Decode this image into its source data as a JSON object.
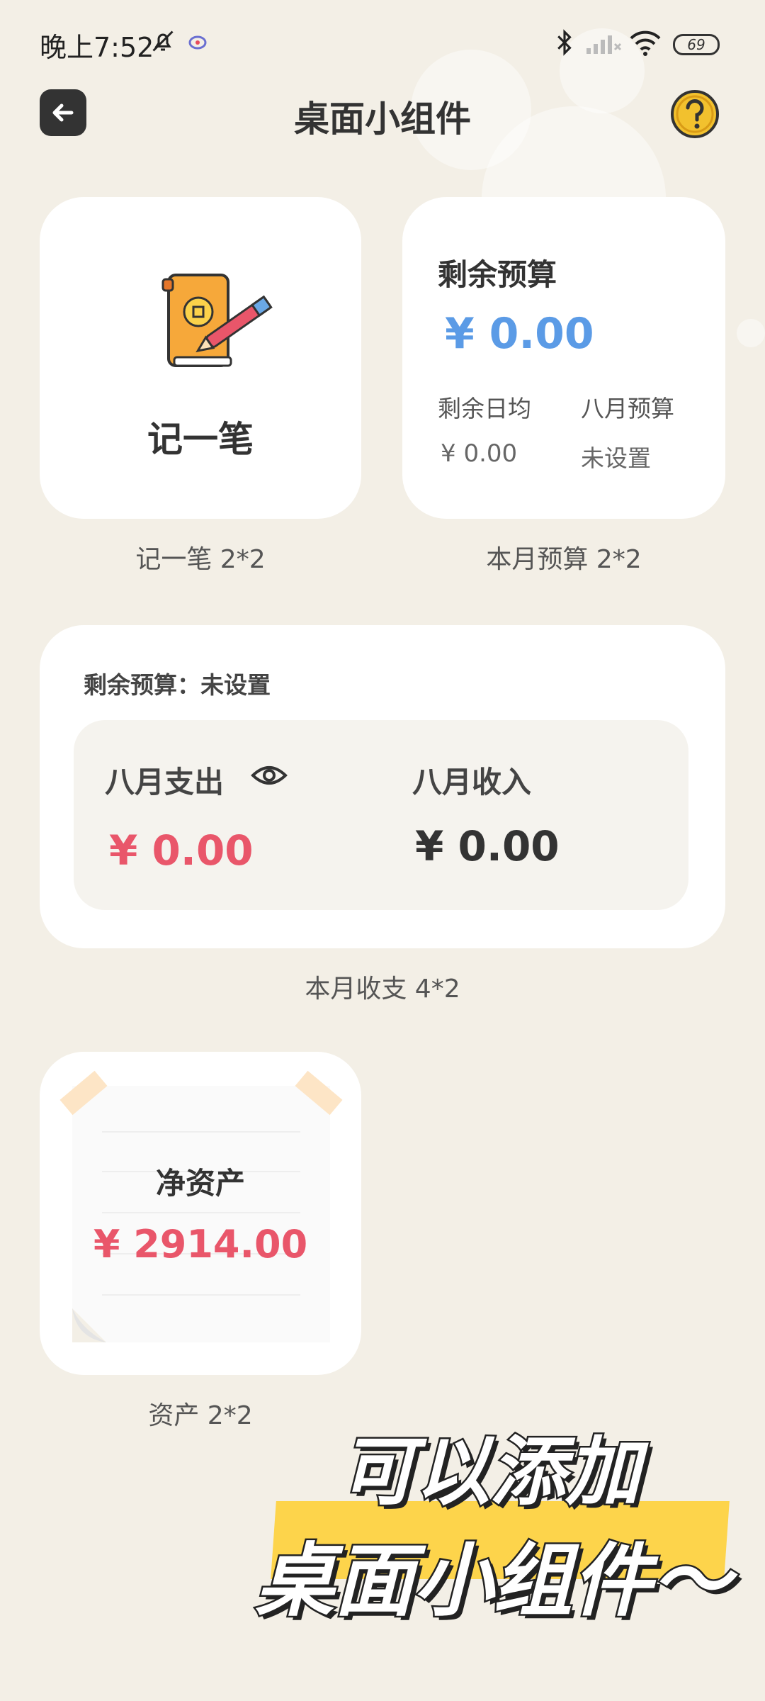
{
  "status_bar": {
    "time": "晚上7:52",
    "battery": "69"
  },
  "header": {
    "title": "桌面小组件"
  },
  "widgets": {
    "record": {
      "label": "记一笔",
      "caption": "记一笔 2*2"
    },
    "budget": {
      "title": "剩余预算",
      "amount": "¥ 0.00",
      "daily_label": "剩余日均",
      "month_label": "八月预算",
      "daily_value": "¥ 0.00",
      "month_value": "未设置",
      "caption": "本月预算 2*2"
    },
    "income_expense": {
      "remaining": "剩余预算：未设置",
      "expense_label": "八月支出",
      "expense_value": "¥ 0.00",
      "income_label": "八月收入",
      "income_value": "¥ 0.00",
      "caption": "本月收支 4*2"
    },
    "assets": {
      "title": "净资产",
      "value": "¥ 2914.00",
      "caption": "资产 2*2"
    }
  },
  "promo": {
    "line1": "可以添加",
    "line2": "桌面小组件～"
  },
  "colors": {
    "background": "#f3efe6",
    "expense_red": "#e9566a",
    "budget_blue": "#5b9be6",
    "highlight_yellow": "#fdd44b"
  }
}
